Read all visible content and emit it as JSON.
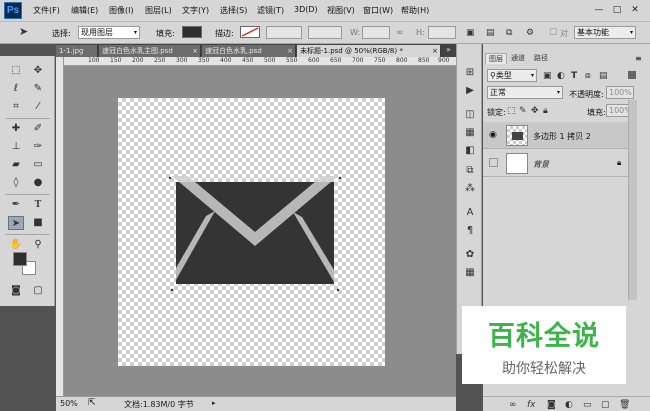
{
  "app": {
    "logo": "Ps"
  },
  "menu": [
    "文件(F)",
    "编辑(E)",
    "图像(I)",
    "图层(L)",
    "文字(Y)",
    "选择(S)",
    "滤镜(T)",
    "3D(D)",
    "视图(V)",
    "窗口(W)",
    "帮助(H)"
  ],
  "window_controls": {
    "minimize": "—",
    "restore": "□",
    "close": "✕"
  },
  "options": {
    "select_label": "选择:",
    "select_value": "现用图层",
    "fill_label": "填充:",
    "stroke_label": "描边:",
    "w_label": "W:",
    "h_label": "H:",
    "align_label": "对",
    "workspace": "基本功能"
  },
  "tabs": [
    "1-1.jpg",
    "速冠白色水乳主图.psd",
    "速冠白色水乳.psd",
    "未标题-1.psd @ 50%(RGB/8) *"
  ],
  "ruler_ticks": [
    "100",
    "150",
    "200",
    "250",
    "300",
    "350",
    "400",
    "450",
    "500",
    "550",
    "600",
    "650",
    "700",
    "750",
    "800",
    "850",
    "900"
  ],
  "status": {
    "zoom": "50%",
    "doc": "文档:1.83M/0 字节"
  },
  "layers_panel": {
    "tabs": [
      "图层",
      "通道",
      "路径"
    ],
    "filter_kind": "类型",
    "blend_mode": "正常",
    "opacity_label": "不透明度:",
    "opacity_value": "100%",
    "lock_label": "锁定:",
    "fill_label": "填充:",
    "fill_value": "100%",
    "layers": [
      {
        "name": "多边形 1 拷贝 2"
      },
      {
        "name": "背景"
      }
    ]
  },
  "watermark": {
    "title": "百科全说",
    "subtitle": "助你轻松解决"
  },
  "colors": {
    "envelope": "#343434",
    "foreground": "#2e2e2e",
    "background": "#ffffff",
    "watermark_green": "#3bb54a"
  }
}
